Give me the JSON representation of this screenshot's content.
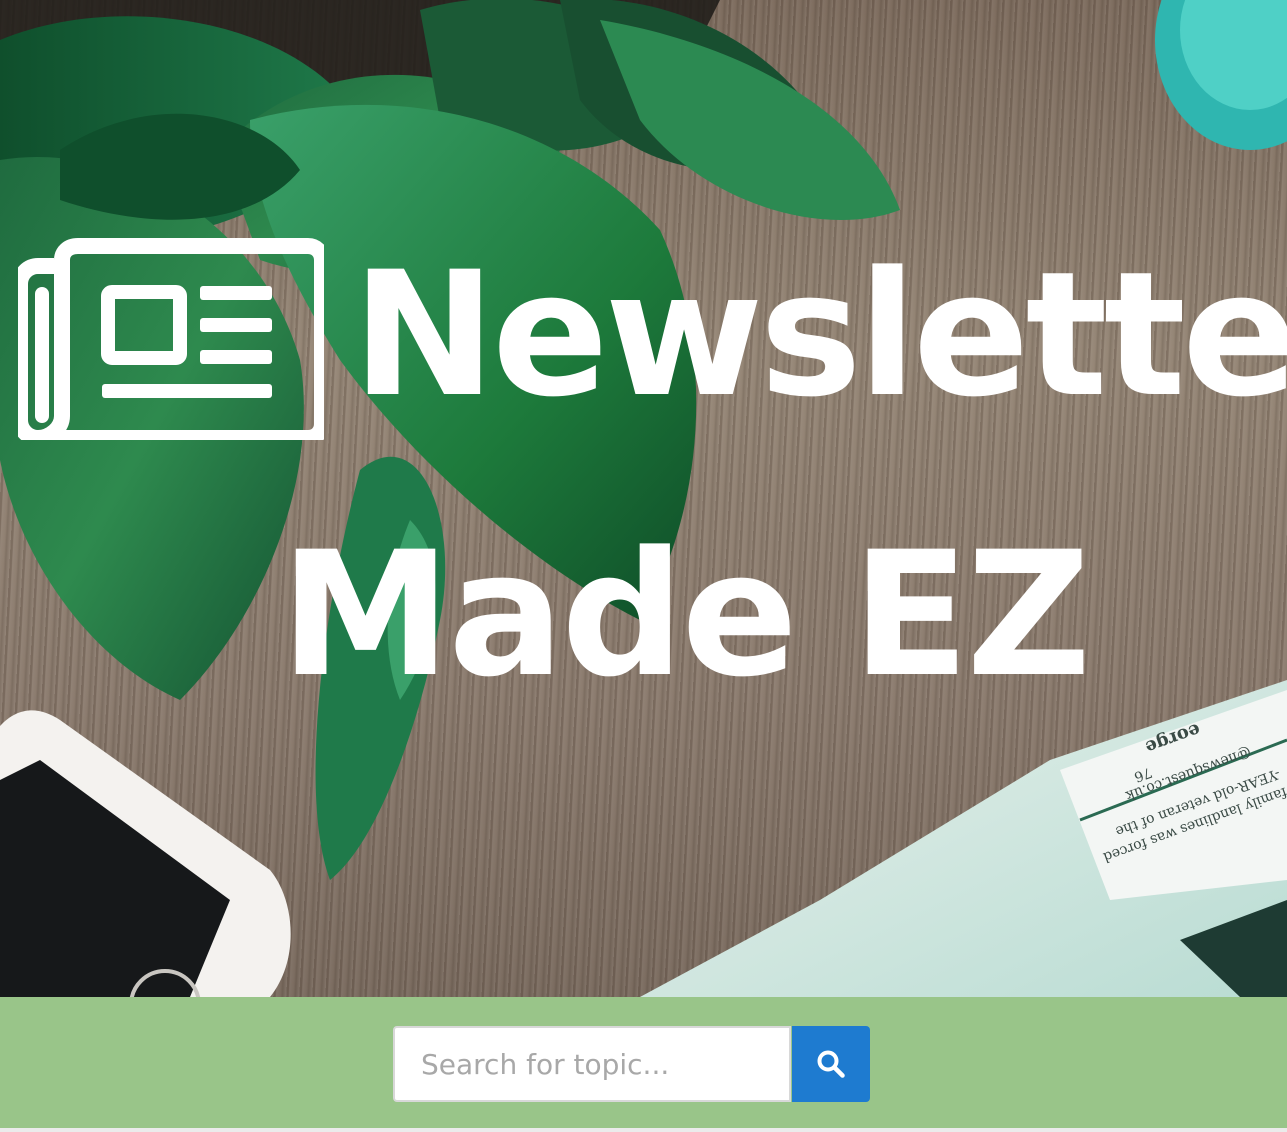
{
  "hero": {
    "title_line1": "Newsletter",
    "title_line2": "Made EZ",
    "logo_icon": "newspaper-icon",
    "newspaper_snippet_lines": [
      "family landlines was forced",
      "-YEAR-old veteran of the",
      "@newsquest.co.uk",
      "76",
      "eorge"
    ]
  },
  "search": {
    "placeholder": "Search for topic...",
    "button_icon": "search-icon"
  },
  "colors": {
    "search_bar_bg": "#99c589",
    "search_button": "#1e7bd0",
    "title_text": "#ffffff"
  }
}
